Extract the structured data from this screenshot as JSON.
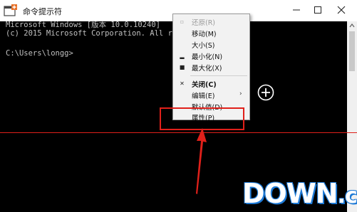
{
  "window": {
    "title": "命令提示符",
    "icon": "cmd-icon",
    "controls": [
      "minimize-icon",
      "maximize-icon",
      "close-icon"
    ]
  },
  "console": {
    "lines": [
      "Microsoft Windows [版本 10.0.10240]",
      "(c) 2015 Microsoft Corporation. All rights reserved.",
      "",
      "C:\\Users\\longg>"
    ]
  },
  "menu": {
    "items": [
      {
        "label": "还原(R)",
        "icon": "restore-icon",
        "disabled": true
      },
      {
        "label": "移动(M)"
      },
      {
        "label": "大小(S)"
      },
      {
        "label": "最小化(N)",
        "icon": "minimize-icon"
      },
      {
        "label": "最大化(X)",
        "icon": "maximize-icon"
      },
      {
        "label": "关闭(C)",
        "icon": "close-icon",
        "bold": true
      },
      {
        "label": "编辑(E)",
        "submenu": true
      },
      {
        "label": "默认值(D)"
      },
      {
        "label": "属性(P)"
      }
    ]
  },
  "watermark": {
    "main": "DOWN",
    "suffix": ".cc"
  },
  "colors": {
    "accent_red": "#e0201a",
    "console_bg": "#000000",
    "console_text": "#c0c0c0",
    "watermark_blue": "#1e7ad6"
  }
}
